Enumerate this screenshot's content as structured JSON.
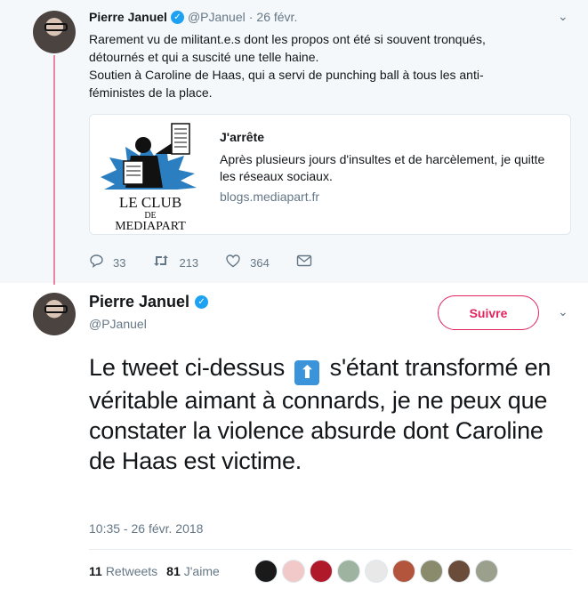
{
  "parent_tweet": {
    "author_name": "Pierre Januel",
    "handle": "@PJanuel",
    "separator": "·",
    "date": "26 févr.",
    "text_lines": [
      "Rarement vu de militant.e.s dont les propos ont été si souvent tronqués,",
      "détournés et qui a suscité une telle haine.",
      "Soutien à Caroline de Haas, qui a servi de punching ball à tous les anti-",
      "féministes de la place."
    ],
    "card": {
      "logo_line1": "LE CLUB",
      "logo_line2": "DE",
      "logo_line3": "MEDIAPART",
      "title": "J'arrête",
      "description": "Après plusieurs jours d'insultes et de harcèlement, je quitte les réseaux sociaux.",
      "domain": "blogs.mediapart.fr"
    },
    "actions": {
      "replies": "33",
      "retweets": "213",
      "likes": "364"
    }
  },
  "main_tweet": {
    "author_name": "Pierre Januel",
    "handle": "@PJanuel",
    "follow_label": "Suivre",
    "text_before": "Le tweet ci-dessus",
    "text_after": "s'étant transformé en véritable aimant à connards, je ne peux que constater la violence absurde dont Caroline de Haas est victime.",
    "timestamp": "10:35 - 26 févr. 2018",
    "retweets_count": "11",
    "retweets_label": "Retweets",
    "likes_count": "81",
    "likes_label": "J'aime",
    "liker_colors": [
      "#1a1a1a",
      "#f2c9c9",
      "#b0192a",
      "#9fb3a1",
      "#e8e8e8",
      "#b2553c",
      "#8a8a6c",
      "#6b4b3a",
      "#9aa08c"
    ]
  },
  "colors": {
    "accent_red": "#e0245e",
    "verified_blue": "#1da1f2",
    "muted_text": "#657786",
    "parent_bg": "#f5f8fa"
  }
}
